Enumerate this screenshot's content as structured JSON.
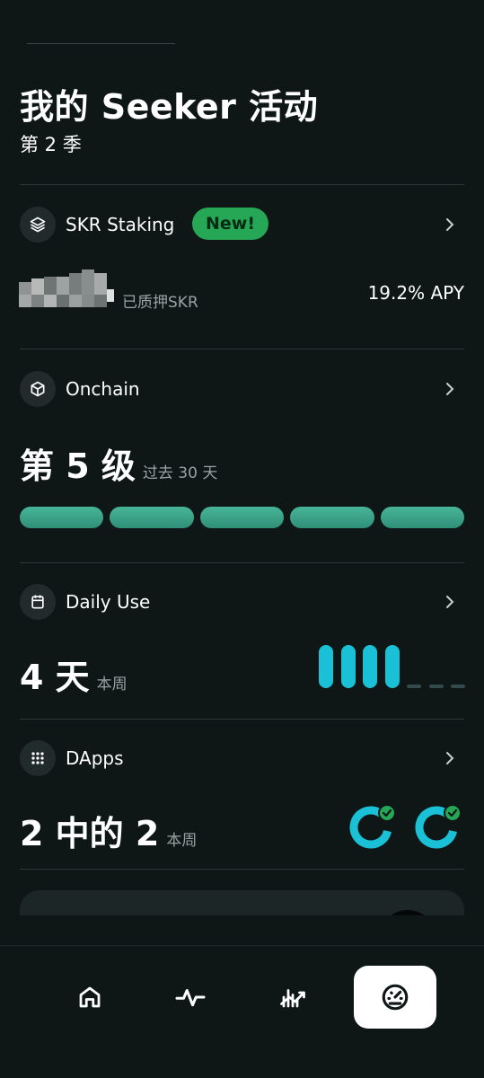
{
  "header": {
    "title": "我的 Seeker 活动",
    "season": "第 2 季"
  },
  "staking": {
    "label": "SKR Staking",
    "badge": "New!",
    "staked_label": "已质押SKR",
    "apy": "19.2% APY",
    "icon": "layers-icon"
  },
  "onchain": {
    "label": "Onchain",
    "level": "第 5 级",
    "period": "过去 30 天",
    "level_value": 5,
    "level_max": 5,
    "icon": "cube-icon"
  },
  "daily_use": {
    "label": "Daily Use",
    "days": "4 天",
    "period": "本周",
    "days_value": 4,
    "days_max": 7,
    "icon": "calendar-icon"
  },
  "dapps": {
    "label": "DApps",
    "count": "2 中的 2",
    "period": "本周",
    "completed": 2,
    "total": 2,
    "icon": "grid-dots-icon"
  },
  "nav": {
    "items": [
      {
        "name": "home",
        "icon": "home-icon",
        "active": false
      },
      {
        "name": "activity",
        "icon": "pulse-icon",
        "active": false
      },
      {
        "name": "trending",
        "icon": "chart-trend-icon",
        "active": false
      },
      {
        "name": "dashboard",
        "icon": "gauge-icon",
        "active": true
      }
    ]
  },
  "colors": {
    "background": "#0e1616",
    "accent_green": "#25a755",
    "level_bar": "#3fa88c",
    "day_bar": "#19c0d6",
    "ring": "#19c0d6"
  }
}
